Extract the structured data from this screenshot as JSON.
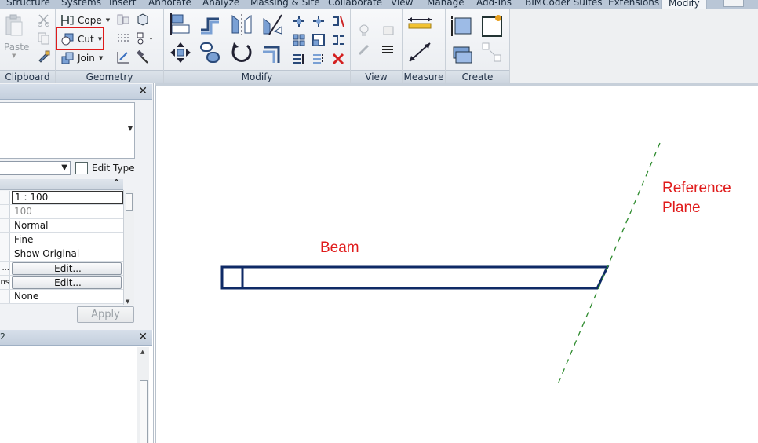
{
  "ribbon_tabs": [
    "Structure",
    "Systems",
    "Insert",
    "Annotate",
    "Analyze",
    "Massing & Site",
    "Collaborate",
    "View",
    "Manage",
    "Add-Ins",
    "BIMCoder Suites",
    "Extensions",
    "Modify"
  ],
  "active_tab": "Modify",
  "panels": {
    "clipboard": {
      "label": "Clipboard",
      "paste": "Paste"
    },
    "geometry": {
      "label": "Geometry",
      "cope": "Cope",
      "cut": "Cut",
      "join": "Join"
    },
    "modify": {
      "label": "Modify"
    },
    "view": {
      "label": "View"
    },
    "measure": {
      "label": "Measure"
    },
    "create": {
      "label": "Create"
    }
  },
  "properties": {
    "edit_type": "Edit Type",
    "rows": [
      {
        "label": "",
        "value": "1 : 100"
      },
      {
        "label": "",
        "value": "100"
      },
      {
        "label": "",
        "value": "Normal"
      },
      {
        "label": "",
        "value": "Fine"
      },
      {
        "label": "",
        "value": "Show Original"
      },
      {
        "label": "...",
        "value": "Edit..."
      },
      {
        "label": "ns",
        "value": "Edit..."
      },
      {
        "label": "",
        "value": "None"
      }
    ],
    "apply": "Apply"
  },
  "browser": {
    "title": "2"
  },
  "canvas": {
    "beam_label": "Beam",
    "ref_plane_label_1": "Reference",
    "ref_plane_label_2": "Plane"
  },
  "colors": {
    "annotation": "#e01b1b",
    "beam_stroke": "#0f2a66",
    "ref_plane": "#2e8b2e",
    "highlight": "#e01b1b"
  },
  "icons": [
    "paste-icon",
    "cut-scissors-icon",
    "copy-icon",
    "match-properties-icon",
    "cope-icon",
    "cut-geometry-icon",
    "join-icon",
    "align-icon",
    "offset-icon",
    "mirror-icon",
    "move-icon",
    "copy-element-icon",
    "rotate-icon",
    "trim-icon",
    "split-icon",
    "array-icon",
    "scale-icon",
    "pin-icon",
    "delete-icon",
    "measure-icon",
    "dimension-icon",
    "create-assembly-icon",
    "create-parts-icon"
  ]
}
